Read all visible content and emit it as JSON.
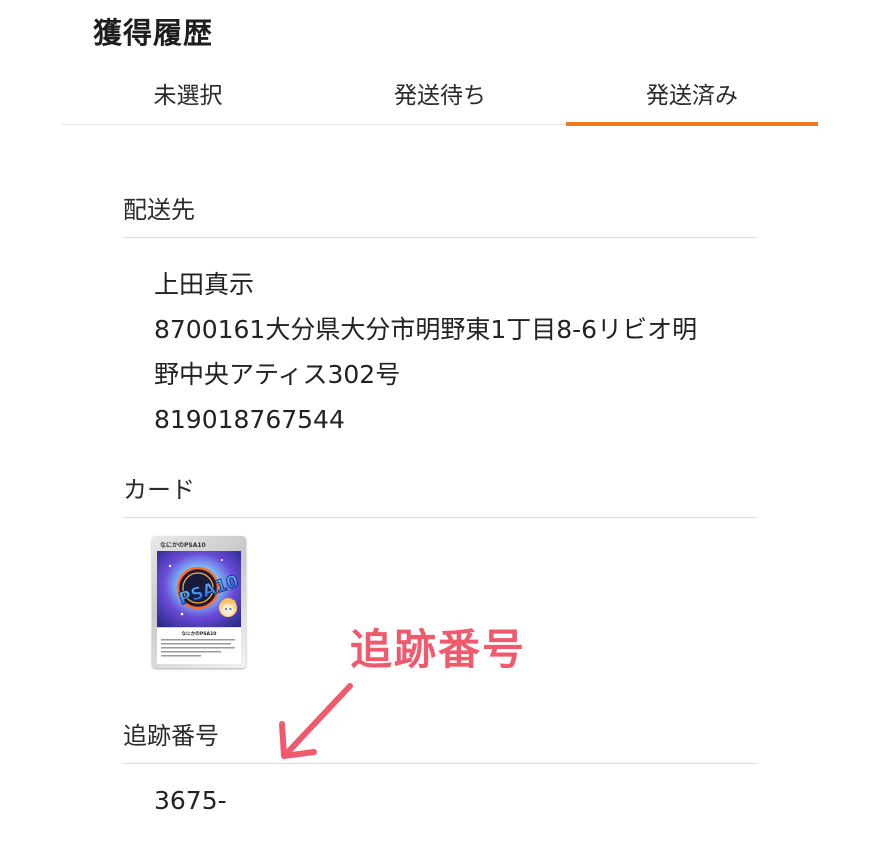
{
  "header": {
    "title": "獲得履歴"
  },
  "tabs": [
    {
      "label": "未選択",
      "active": false
    },
    {
      "label": "発送待ち",
      "active": false
    },
    {
      "label": "発送済み",
      "active": true
    }
  ],
  "shipping": {
    "heading": "配送先",
    "name": "上田真示",
    "address_line1": "8700161大分県大分市明野東1丁目8-6リビオ明",
    "address_line2": "野中央アティス302号",
    "phone": "819018767544"
  },
  "card": {
    "heading": "カード",
    "card_title": "なにかのPSA10",
    "card_logo": "PSA10",
    "card_subtitle": "なにかのPSA10",
    "card_text": "発送すると、PT付与のPSA10ランダムに発送されます。"
  },
  "tracking": {
    "heading": "追跡番号",
    "value": "3675-"
  },
  "annotation": {
    "label": "追跡番号",
    "color": "#ef5b6d"
  },
  "colors": {
    "accent": "#f07a1e",
    "annotation": "#ef5b6d"
  }
}
